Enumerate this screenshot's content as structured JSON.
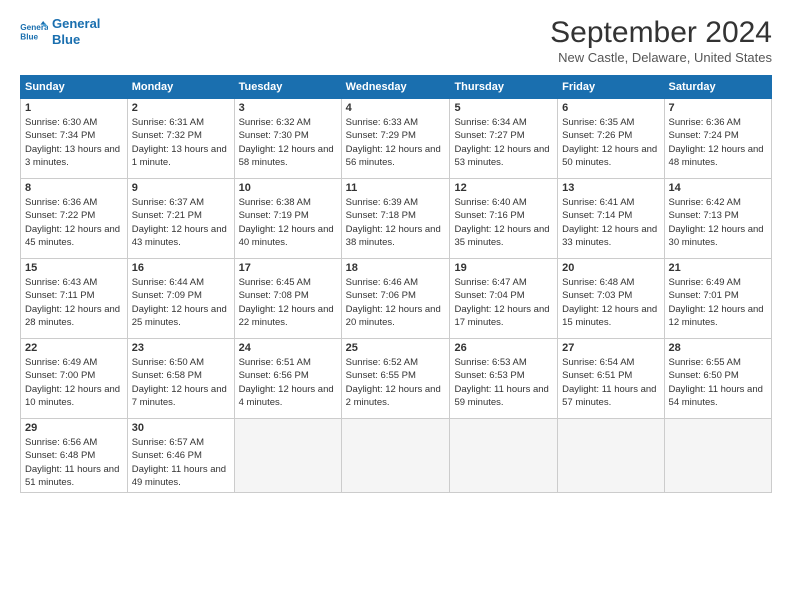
{
  "header": {
    "logo_line1": "General",
    "logo_line2": "Blue",
    "month": "September 2024",
    "location": "New Castle, Delaware, United States"
  },
  "weekdays": [
    "Sunday",
    "Monday",
    "Tuesday",
    "Wednesday",
    "Thursday",
    "Friday",
    "Saturday"
  ],
  "weeks": [
    [
      {
        "day": "1",
        "sunrise": "Sunrise: 6:30 AM",
        "sunset": "Sunset: 7:34 PM",
        "daylight": "Daylight: 13 hours and 3 minutes."
      },
      {
        "day": "2",
        "sunrise": "Sunrise: 6:31 AM",
        "sunset": "Sunset: 7:32 PM",
        "daylight": "Daylight: 13 hours and 1 minute."
      },
      {
        "day": "3",
        "sunrise": "Sunrise: 6:32 AM",
        "sunset": "Sunset: 7:30 PM",
        "daylight": "Daylight: 12 hours and 58 minutes."
      },
      {
        "day": "4",
        "sunrise": "Sunrise: 6:33 AM",
        "sunset": "Sunset: 7:29 PM",
        "daylight": "Daylight: 12 hours and 56 minutes."
      },
      {
        "day": "5",
        "sunrise": "Sunrise: 6:34 AM",
        "sunset": "Sunset: 7:27 PM",
        "daylight": "Daylight: 12 hours and 53 minutes."
      },
      {
        "day": "6",
        "sunrise": "Sunrise: 6:35 AM",
        "sunset": "Sunset: 7:26 PM",
        "daylight": "Daylight: 12 hours and 50 minutes."
      },
      {
        "day": "7",
        "sunrise": "Sunrise: 6:36 AM",
        "sunset": "Sunset: 7:24 PM",
        "daylight": "Daylight: 12 hours and 48 minutes."
      }
    ],
    [
      {
        "day": "8",
        "sunrise": "Sunrise: 6:36 AM",
        "sunset": "Sunset: 7:22 PM",
        "daylight": "Daylight: 12 hours and 45 minutes."
      },
      {
        "day": "9",
        "sunrise": "Sunrise: 6:37 AM",
        "sunset": "Sunset: 7:21 PM",
        "daylight": "Daylight: 12 hours and 43 minutes."
      },
      {
        "day": "10",
        "sunrise": "Sunrise: 6:38 AM",
        "sunset": "Sunset: 7:19 PM",
        "daylight": "Daylight: 12 hours and 40 minutes."
      },
      {
        "day": "11",
        "sunrise": "Sunrise: 6:39 AM",
        "sunset": "Sunset: 7:18 PM",
        "daylight": "Daylight: 12 hours and 38 minutes."
      },
      {
        "day": "12",
        "sunrise": "Sunrise: 6:40 AM",
        "sunset": "Sunset: 7:16 PM",
        "daylight": "Daylight: 12 hours and 35 minutes."
      },
      {
        "day": "13",
        "sunrise": "Sunrise: 6:41 AM",
        "sunset": "Sunset: 7:14 PM",
        "daylight": "Daylight: 12 hours and 33 minutes."
      },
      {
        "day": "14",
        "sunrise": "Sunrise: 6:42 AM",
        "sunset": "Sunset: 7:13 PM",
        "daylight": "Daylight: 12 hours and 30 minutes."
      }
    ],
    [
      {
        "day": "15",
        "sunrise": "Sunrise: 6:43 AM",
        "sunset": "Sunset: 7:11 PM",
        "daylight": "Daylight: 12 hours and 28 minutes."
      },
      {
        "day": "16",
        "sunrise": "Sunrise: 6:44 AM",
        "sunset": "Sunset: 7:09 PM",
        "daylight": "Daylight: 12 hours and 25 minutes."
      },
      {
        "day": "17",
        "sunrise": "Sunrise: 6:45 AM",
        "sunset": "Sunset: 7:08 PM",
        "daylight": "Daylight: 12 hours and 22 minutes."
      },
      {
        "day": "18",
        "sunrise": "Sunrise: 6:46 AM",
        "sunset": "Sunset: 7:06 PM",
        "daylight": "Daylight: 12 hours and 20 minutes."
      },
      {
        "day": "19",
        "sunrise": "Sunrise: 6:47 AM",
        "sunset": "Sunset: 7:04 PM",
        "daylight": "Daylight: 12 hours and 17 minutes."
      },
      {
        "day": "20",
        "sunrise": "Sunrise: 6:48 AM",
        "sunset": "Sunset: 7:03 PM",
        "daylight": "Daylight: 12 hours and 15 minutes."
      },
      {
        "day": "21",
        "sunrise": "Sunrise: 6:49 AM",
        "sunset": "Sunset: 7:01 PM",
        "daylight": "Daylight: 12 hours and 12 minutes."
      }
    ],
    [
      {
        "day": "22",
        "sunrise": "Sunrise: 6:49 AM",
        "sunset": "Sunset: 7:00 PM",
        "daylight": "Daylight: 12 hours and 10 minutes."
      },
      {
        "day": "23",
        "sunrise": "Sunrise: 6:50 AM",
        "sunset": "Sunset: 6:58 PM",
        "daylight": "Daylight: 12 hours and 7 minutes."
      },
      {
        "day": "24",
        "sunrise": "Sunrise: 6:51 AM",
        "sunset": "Sunset: 6:56 PM",
        "daylight": "Daylight: 12 hours and 4 minutes."
      },
      {
        "day": "25",
        "sunrise": "Sunrise: 6:52 AM",
        "sunset": "Sunset: 6:55 PM",
        "daylight": "Daylight: 12 hours and 2 minutes."
      },
      {
        "day": "26",
        "sunrise": "Sunrise: 6:53 AM",
        "sunset": "Sunset: 6:53 PM",
        "daylight": "Daylight: 11 hours and 59 minutes."
      },
      {
        "day": "27",
        "sunrise": "Sunrise: 6:54 AM",
        "sunset": "Sunset: 6:51 PM",
        "daylight": "Daylight: 11 hours and 57 minutes."
      },
      {
        "day": "28",
        "sunrise": "Sunrise: 6:55 AM",
        "sunset": "Sunset: 6:50 PM",
        "daylight": "Daylight: 11 hours and 54 minutes."
      }
    ],
    [
      {
        "day": "29",
        "sunrise": "Sunrise: 6:56 AM",
        "sunset": "Sunset: 6:48 PM",
        "daylight": "Daylight: 11 hours and 51 minutes."
      },
      {
        "day": "30",
        "sunrise": "Sunrise: 6:57 AM",
        "sunset": "Sunset: 6:46 PM",
        "daylight": "Daylight: 11 hours and 49 minutes."
      },
      null,
      null,
      null,
      null,
      null
    ]
  ]
}
